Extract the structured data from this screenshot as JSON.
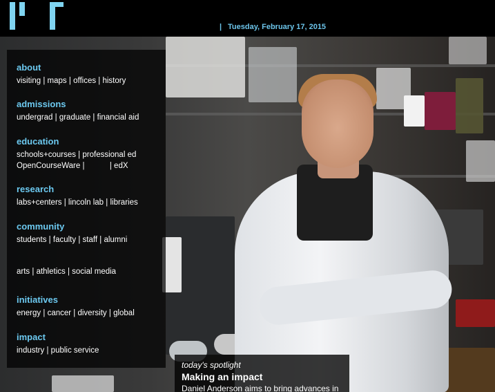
{
  "header": {
    "date_separator": "|",
    "date": "Tuesday, February 17, 2015",
    "logo_icon": "mit-logo-icon"
  },
  "nav": {
    "about": {
      "heading": "about",
      "links": [
        "visiting",
        "maps",
        "offices",
        "history"
      ]
    },
    "admissions": {
      "heading": "admissions",
      "links": [
        "undergrad",
        "graduate",
        "financial aid"
      ]
    },
    "education": {
      "heading": "education",
      "links_row1": [
        "schools+courses",
        "professional ed"
      ],
      "links_row2": [
        "OpenCourseWare",
        "edX"
      ]
    },
    "research": {
      "heading": "research",
      "links": [
        "labs+centers",
        "lincoln lab",
        "libraries"
      ]
    },
    "community": {
      "heading": "community",
      "links_row1": [
        "students",
        "faculty",
        "staff",
        "alumni"
      ],
      "links_row2": [
        "arts",
        "athletics",
        "social media"
      ]
    },
    "initiatives": {
      "heading": "initiatives",
      "links": [
        "energy",
        "cancer",
        "diversity",
        "global"
      ]
    },
    "impact": {
      "heading": "impact",
      "links": [
        "industry",
        "public service"
      ]
    }
  },
  "spotlight": {
    "kicker": "today's spotlight",
    "title": "Making an impact",
    "description": "Daniel Anderson aims to bring advances in"
  },
  "colors": {
    "accent": "#6cc9f0",
    "background": "#000000"
  }
}
